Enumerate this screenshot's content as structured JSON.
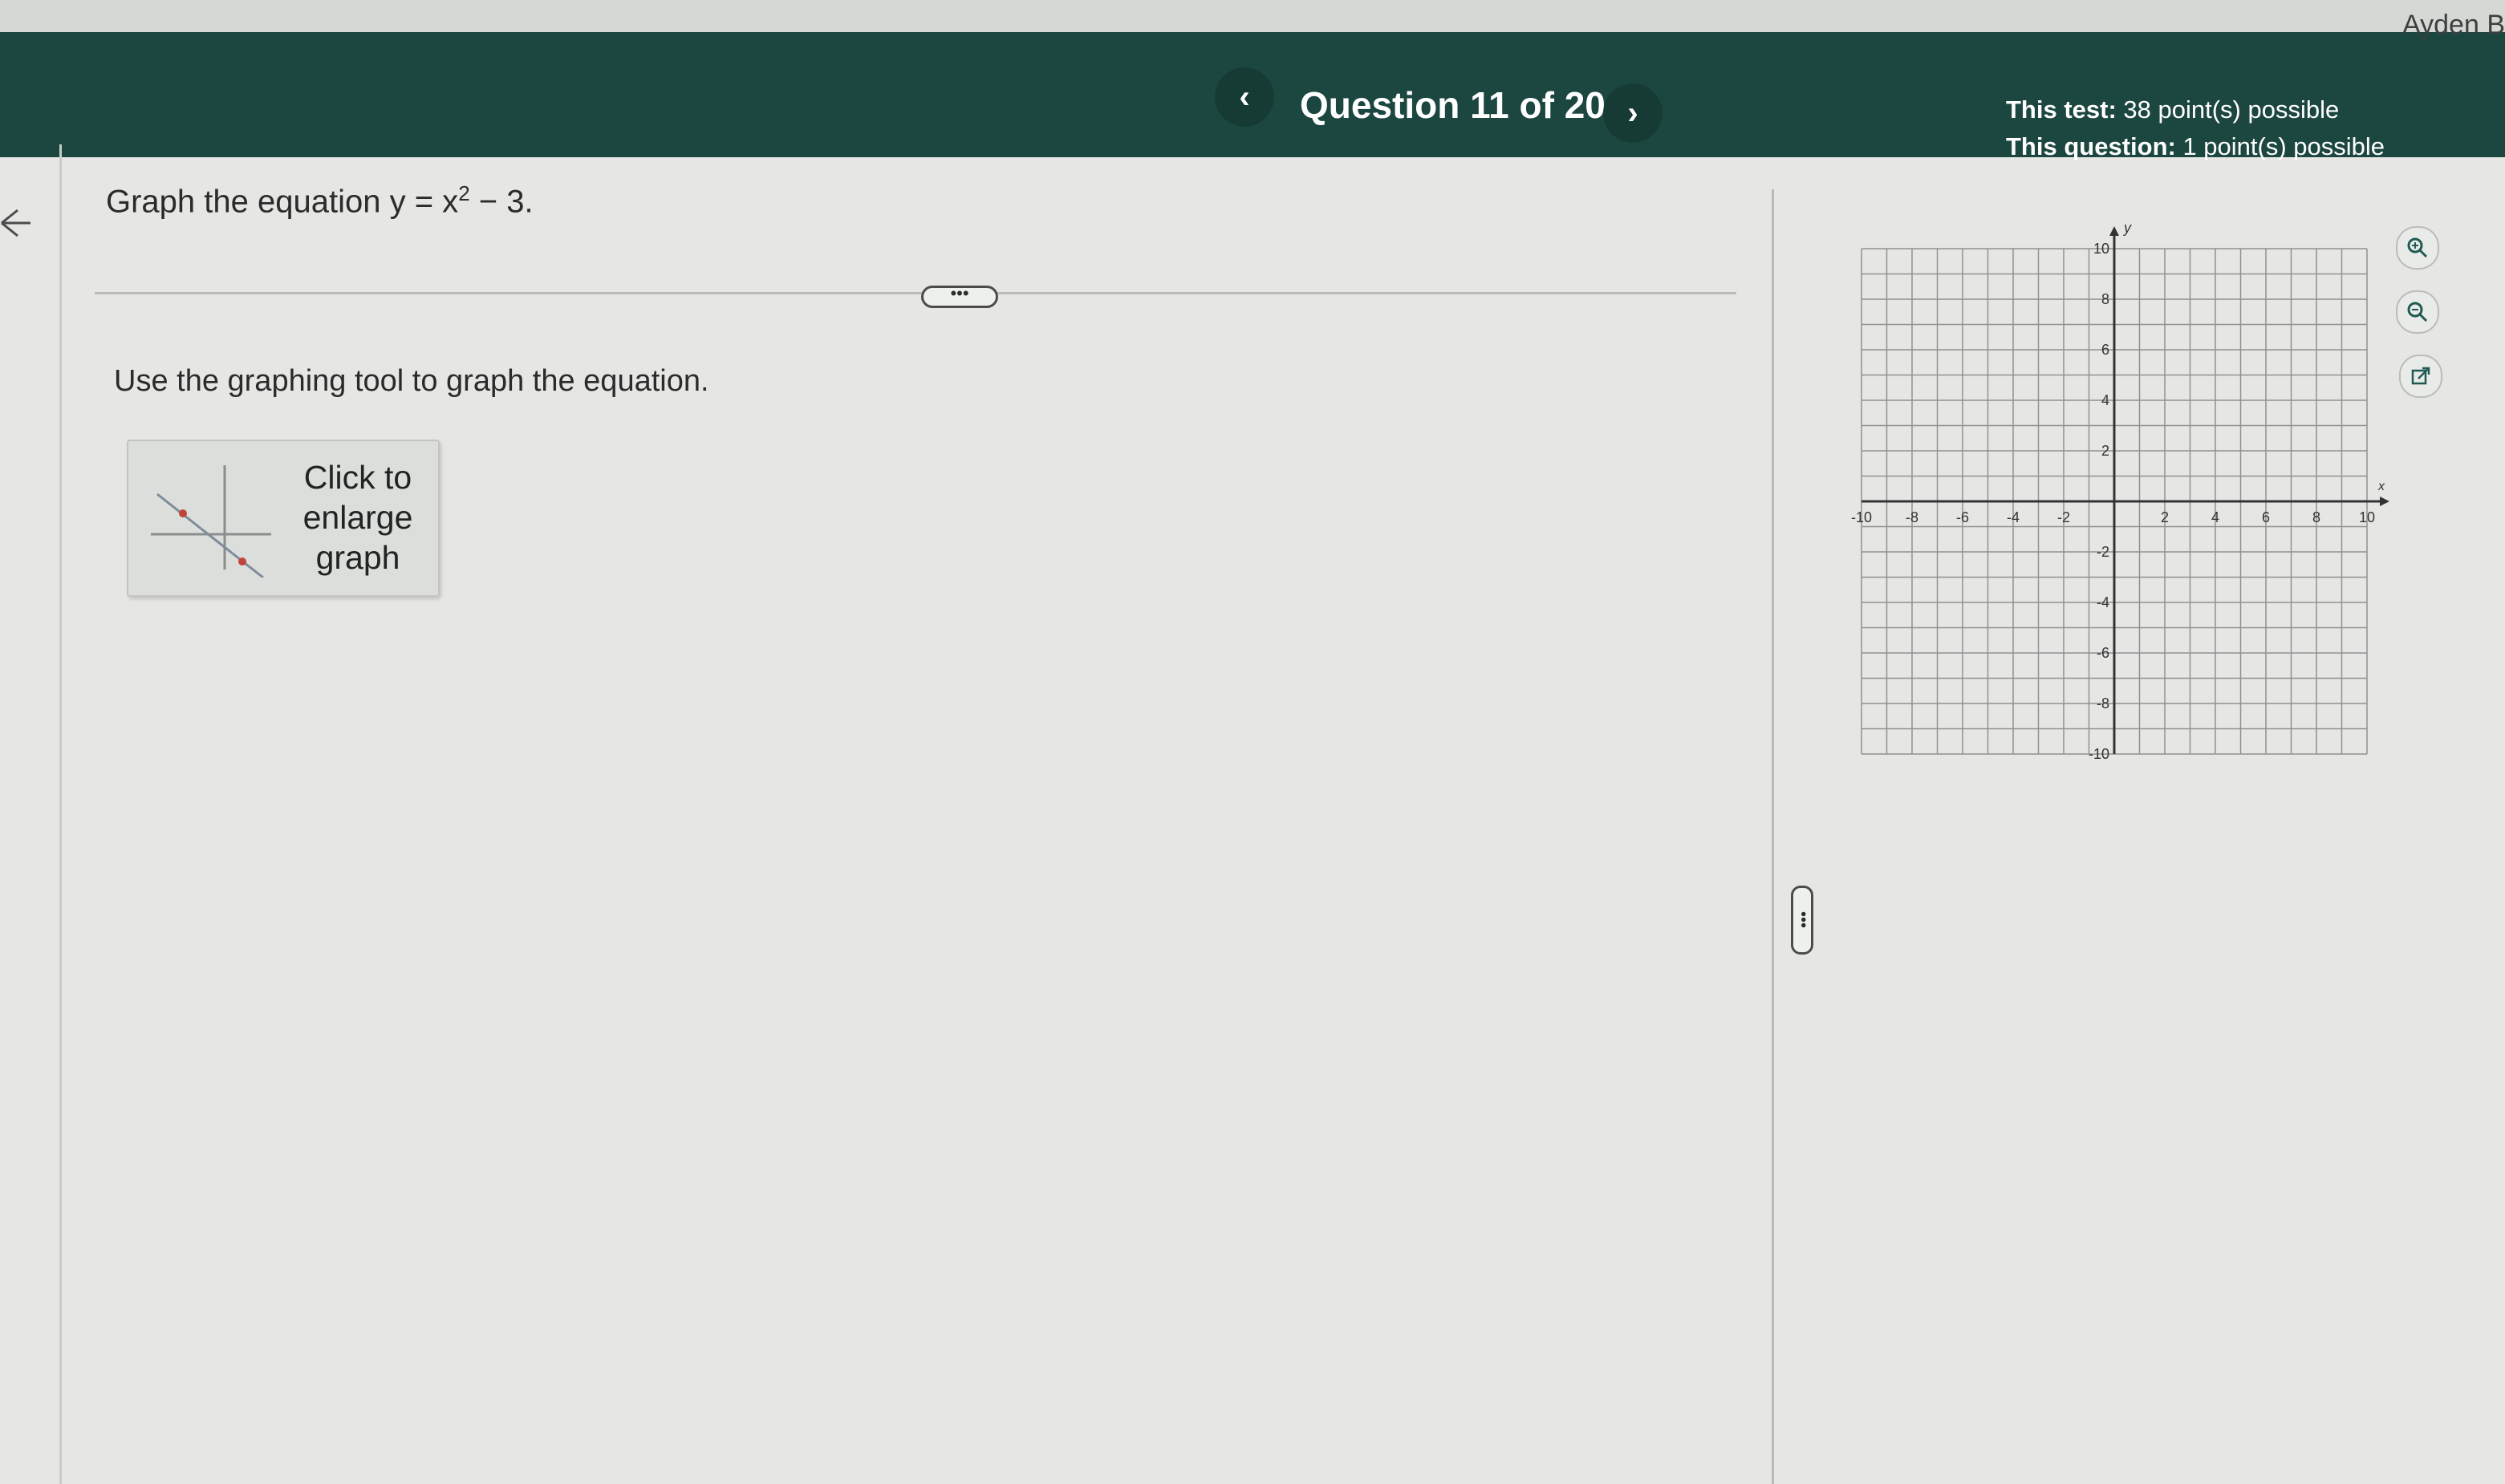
{
  "header": {
    "user": "Ayden B",
    "question_title": "Question 11 of 20",
    "prev_icon": "‹",
    "next_icon": "›",
    "points": {
      "test_label": "This test:",
      "test_value": "38 point(s) possible",
      "question_label": "This question:",
      "question_value": "1 point(s) possible"
    }
  },
  "question": {
    "prompt_prefix": "Graph the equation y = x",
    "prompt_exponent": "2",
    "prompt_suffix": " − 3.",
    "divider_label": "•••",
    "instruction": "Use the graphing tool to graph the equation.",
    "enlarge": {
      "line1": "Click to",
      "line2": "enlarge",
      "line3": "graph"
    }
  },
  "pane_handle_label": "•••",
  "graph": {
    "x_label": "x",
    "y_label": "y",
    "x_range": [
      -10,
      10
    ],
    "y_range": [
      -10,
      10
    ],
    "grid": true,
    "x_ticks": [
      "-10",
      "-8",
      "-6",
      "-4",
      "-2",
      "2",
      "4",
      "6",
      "8",
      "10"
    ],
    "y_ticks": [
      "10",
      "8",
      "6",
      "4",
      "2",
      "-2",
      "-4",
      "-6",
      "-8",
      "-10"
    ],
    "tools": [
      "zoom-in-icon",
      "zoom-out-icon",
      "popout-icon"
    ]
  }
}
